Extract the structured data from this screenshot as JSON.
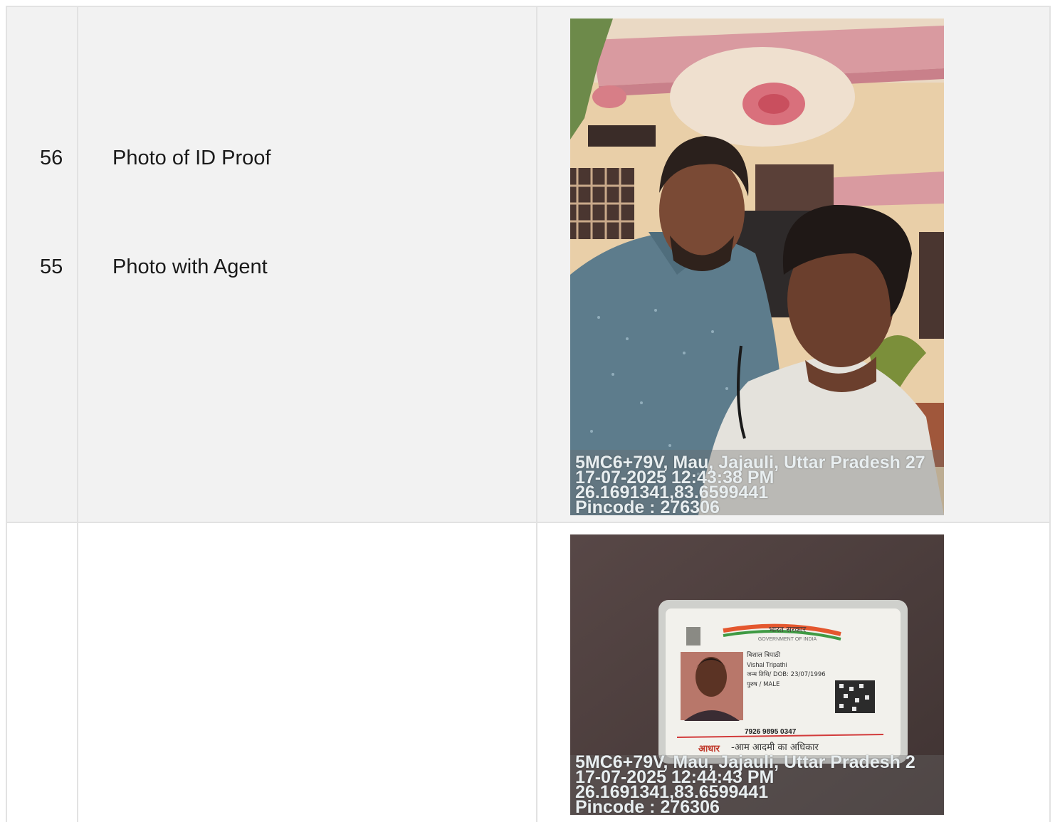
{
  "rows": [
    {
      "number": "55",
      "label": "Photo with Agent",
      "photo": {
        "subject": "selfie of two men in front of a house",
        "overlay_lines": [
          "5MC6+79V, Mau, Jajauli, Uttar Pradesh 27",
          "17-07-2025 12:43:38 PM",
          "26.1691341,83.6599441",
          "Pincode : 276306"
        ]
      }
    },
    {
      "number": "56",
      "label": "Photo of ID Proof",
      "photo": {
        "subject": "Aadhaar card on dark surface",
        "card": {
          "header_hindi": "भारत सरकार",
          "header_english": "GOVERNMENT OF INDIA",
          "name_hindi": "विशाल त्रिपाठी",
          "name_english": "Vishal Tripathi",
          "dob_line": "जन्म तिथि/ DOB: 23/07/1996",
          "gender_line": "पुरुष / MALE",
          "number": "7926 9895 0347",
          "footer_red": "आधार",
          "footer_rest": "-आम आदमी का अधिकार"
        },
        "overlay_lines": [
          "5MC6+79V, Mau, Jajauli, Uttar Pradesh 2",
          "17-07-2025 12:44:43 PM",
          "26.1691341,83.6599441",
          "Pincode : 276306"
        ]
      }
    }
  ]
}
